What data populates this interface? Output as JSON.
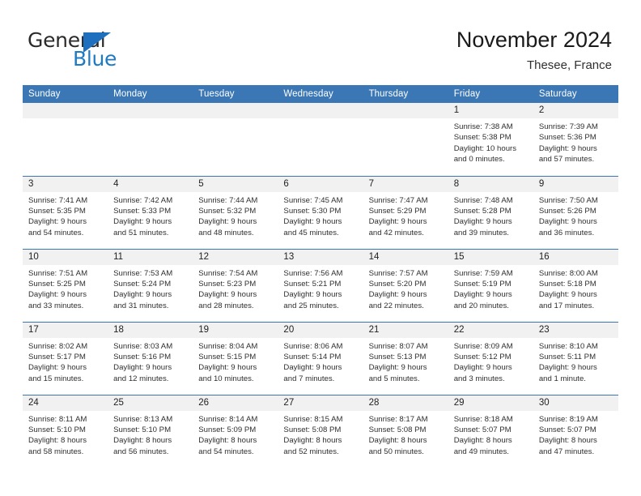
{
  "brand": {
    "name_part1": "General",
    "name_part2": "Blue",
    "mark": "triangle-logo"
  },
  "header": {
    "title": "November 2024",
    "location": "Thesee, France"
  },
  "calendar": {
    "weekday_headers": [
      "Sunday",
      "Monday",
      "Tuesday",
      "Wednesday",
      "Thursday",
      "Friday",
      "Saturday"
    ],
    "accent_color": "#3c77b5",
    "daynum_band_color": "#f1f1f1",
    "weeks": [
      [
        {
          "day": "",
          "empty": true,
          "lines": [
            "",
            "",
            "",
            ""
          ]
        },
        {
          "day": "",
          "empty": true,
          "lines": [
            "",
            "",
            "",
            ""
          ]
        },
        {
          "day": "",
          "empty": true,
          "lines": [
            "",
            "",
            "",
            ""
          ]
        },
        {
          "day": "",
          "empty": true,
          "lines": [
            "",
            "",
            "",
            ""
          ]
        },
        {
          "day": "",
          "empty": true,
          "lines": [
            "",
            "",
            "",
            ""
          ]
        },
        {
          "day": "1",
          "empty": false,
          "lines": [
            "Sunrise: 7:38 AM",
            "Sunset: 5:38 PM",
            "Daylight: 10 hours",
            "and 0 minutes."
          ]
        },
        {
          "day": "2",
          "empty": false,
          "lines": [
            "Sunrise: 7:39 AM",
            "Sunset: 5:36 PM",
            "Daylight: 9 hours",
            "and 57 minutes."
          ]
        }
      ],
      [
        {
          "day": "3",
          "empty": false,
          "lines": [
            "Sunrise: 7:41 AM",
            "Sunset: 5:35 PM",
            "Daylight: 9 hours",
            "and 54 minutes."
          ]
        },
        {
          "day": "4",
          "empty": false,
          "lines": [
            "Sunrise: 7:42 AM",
            "Sunset: 5:33 PM",
            "Daylight: 9 hours",
            "and 51 minutes."
          ]
        },
        {
          "day": "5",
          "empty": false,
          "lines": [
            "Sunrise: 7:44 AM",
            "Sunset: 5:32 PM",
            "Daylight: 9 hours",
            "and 48 minutes."
          ]
        },
        {
          "day": "6",
          "empty": false,
          "lines": [
            "Sunrise: 7:45 AM",
            "Sunset: 5:30 PM",
            "Daylight: 9 hours",
            "and 45 minutes."
          ]
        },
        {
          "day": "7",
          "empty": false,
          "lines": [
            "Sunrise: 7:47 AM",
            "Sunset: 5:29 PM",
            "Daylight: 9 hours",
            "and 42 minutes."
          ]
        },
        {
          "day": "8",
          "empty": false,
          "lines": [
            "Sunrise: 7:48 AM",
            "Sunset: 5:28 PM",
            "Daylight: 9 hours",
            "and 39 minutes."
          ]
        },
        {
          "day": "9",
          "empty": false,
          "lines": [
            "Sunrise: 7:50 AM",
            "Sunset: 5:26 PM",
            "Daylight: 9 hours",
            "and 36 minutes."
          ]
        }
      ],
      [
        {
          "day": "10",
          "empty": false,
          "lines": [
            "Sunrise: 7:51 AM",
            "Sunset: 5:25 PM",
            "Daylight: 9 hours",
            "and 33 minutes."
          ]
        },
        {
          "day": "11",
          "empty": false,
          "lines": [
            "Sunrise: 7:53 AM",
            "Sunset: 5:24 PM",
            "Daylight: 9 hours",
            "and 31 minutes."
          ]
        },
        {
          "day": "12",
          "empty": false,
          "lines": [
            "Sunrise: 7:54 AM",
            "Sunset: 5:23 PM",
            "Daylight: 9 hours",
            "and 28 minutes."
          ]
        },
        {
          "day": "13",
          "empty": false,
          "lines": [
            "Sunrise: 7:56 AM",
            "Sunset: 5:21 PM",
            "Daylight: 9 hours",
            "and 25 minutes."
          ]
        },
        {
          "day": "14",
          "empty": false,
          "lines": [
            "Sunrise: 7:57 AM",
            "Sunset: 5:20 PM",
            "Daylight: 9 hours",
            "and 22 minutes."
          ]
        },
        {
          "day": "15",
          "empty": false,
          "lines": [
            "Sunrise: 7:59 AM",
            "Sunset: 5:19 PM",
            "Daylight: 9 hours",
            "and 20 minutes."
          ]
        },
        {
          "day": "16",
          "empty": false,
          "lines": [
            "Sunrise: 8:00 AM",
            "Sunset: 5:18 PM",
            "Daylight: 9 hours",
            "and 17 minutes."
          ]
        }
      ],
      [
        {
          "day": "17",
          "empty": false,
          "lines": [
            "Sunrise: 8:02 AM",
            "Sunset: 5:17 PM",
            "Daylight: 9 hours",
            "and 15 minutes."
          ]
        },
        {
          "day": "18",
          "empty": false,
          "lines": [
            "Sunrise: 8:03 AM",
            "Sunset: 5:16 PM",
            "Daylight: 9 hours",
            "and 12 minutes."
          ]
        },
        {
          "day": "19",
          "empty": false,
          "lines": [
            "Sunrise: 8:04 AM",
            "Sunset: 5:15 PM",
            "Daylight: 9 hours",
            "and 10 minutes."
          ]
        },
        {
          "day": "20",
          "empty": false,
          "lines": [
            "Sunrise: 8:06 AM",
            "Sunset: 5:14 PM",
            "Daylight: 9 hours",
            "and 7 minutes."
          ]
        },
        {
          "day": "21",
          "empty": false,
          "lines": [
            "Sunrise: 8:07 AM",
            "Sunset: 5:13 PM",
            "Daylight: 9 hours",
            "and 5 minutes."
          ]
        },
        {
          "day": "22",
          "empty": false,
          "lines": [
            "Sunrise: 8:09 AM",
            "Sunset: 5:12 PM",
            "Daylight: 9 hours",
            "and 3 minutes."
          ]
        },
        {
          "day": "23",
          "empty": false,
          "lines": [
            "Sunrise: 8:10 AM",
            "Sunset: 5:11 PM",
            "Daylight: 9 hours",
            "and 1 minute."
          ]
        }
      ],
      [
        {
          "day": "24",
          "empty": false,
          "lines": [
            "Sunrise: 8:11 AM",
            "Sunset: 5:10 PM",
            "Daylight: 8 hours",
            "and 58 minutes."
          ]
        },
        {
          "day": "25",
          "empty": false,
          "lines": [
            "Sunrise: 8:13 AM",
            "Sunset: 5:10 PM",
            "Daylight: 8 hours",
            "and 56 minutes."
          ]
        },
        {
          "day": "26",
          "empty": false,
          "lines": [
            "Sunrise: 8:14 AM",
            "Sunset: 5:09 PM",
            "Daylight: 8 hours",
            "and 54 minutes."
          ]
        },
        {
          "day": "27",
          "empty": false,
          "lines": [
            "Sunrise: 8:15 AM",
            "Sunset: 5:08 PM",
            "Daylight: 8 hours",
            "and 52 minutes."
          ]
        },
        {
          "day": "28",
          "empty": false,
          "lines": [
            "Sunrise: 8:17 AM",
            "Sunset: 5:08 PM",
            "Daylight: 8 hours",
            "and 50 minutes."
          ]
        },
        {
          "day": "29",
          "empty": false,
          "lines": [
            "Sunrise: 8:18 AM",
            "Sunset: 5:07 PM",
            "Daylight: 8 hours",
            "and 49 minutes."
          ]
        },
        {
          "day": "30",
          "empty": false,
          "lines": [
            "Sunrise: 8:19 AM",
            "Sunset: 5:07 PM",
            "Daylight: 8 hours",
            "and 47 minutes."
          ]
        }
      ]
    ]
  }
}
